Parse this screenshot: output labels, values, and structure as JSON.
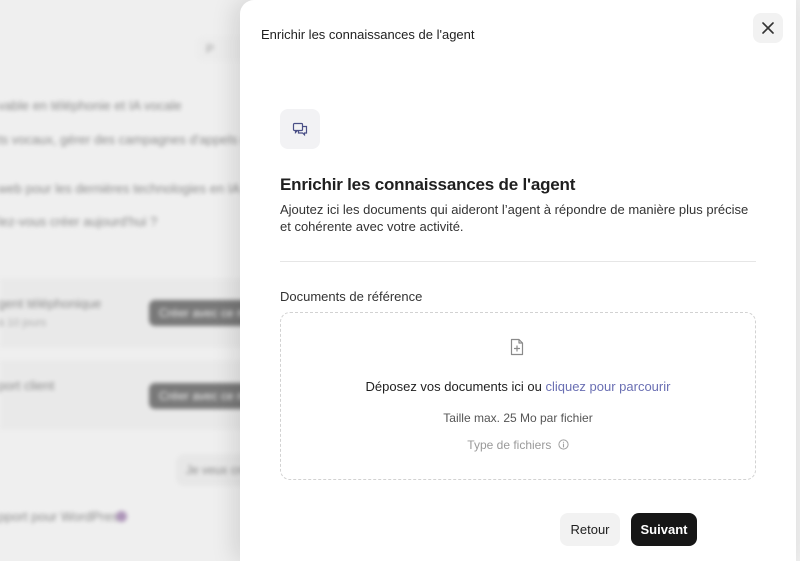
{
  "background": {
    "top_button": "P",
    "lines": [
      "vable en téléphonie et IA vocale",
      "ts vocaux, gérer des campagnes d'appels et a",
      "web pour les dernières technologies en IA voca",
      "lez-vous créer aujourd'hui ?"
    ],
    "cards": [
      {
        "title": "gent téléphonique",
        "subtitle": "à 10 jours",
        "button": "Créer avec ce m"
      },
      {
        "title": "port client",
        "subtitle": "",
        "button": "Créer avec ce m"
      }
    ],
    "pill": "Je veux cré",
    "footer": "pport pour WordPress"
  },
  "drawer": {
    "title": "Enrichir les connaissances de l'agent",
    "close_icon": "close-icon",
    "header_icon": "chat-bubbles-icon",
    "heading": "Enrichir les connaissances de l'agent",
    "description": "Ajoutez ici les documents qui aideront l’agent à répondre de manière plus précise et cohérente avec votre activité.",
    "section_label": "Documents de référence",
    "dropzone": {
      "icon": "file-plus-icon",
      "prompt": "Déposez vos documents ici ou",
      "browse_link": "cliquez pour parcourir",
      "size_limit": "Taille max. 25 Mo par fichier",
      "file_types": "Type de fichiers",
      "info_icon": "info-icon"
    },
    "back_button": "Retour",
    "next_button": "Suivant"
  },
  "colors": {
    "link": "#6a6fb3",
    "primary_button": "#161616"
  }
}
